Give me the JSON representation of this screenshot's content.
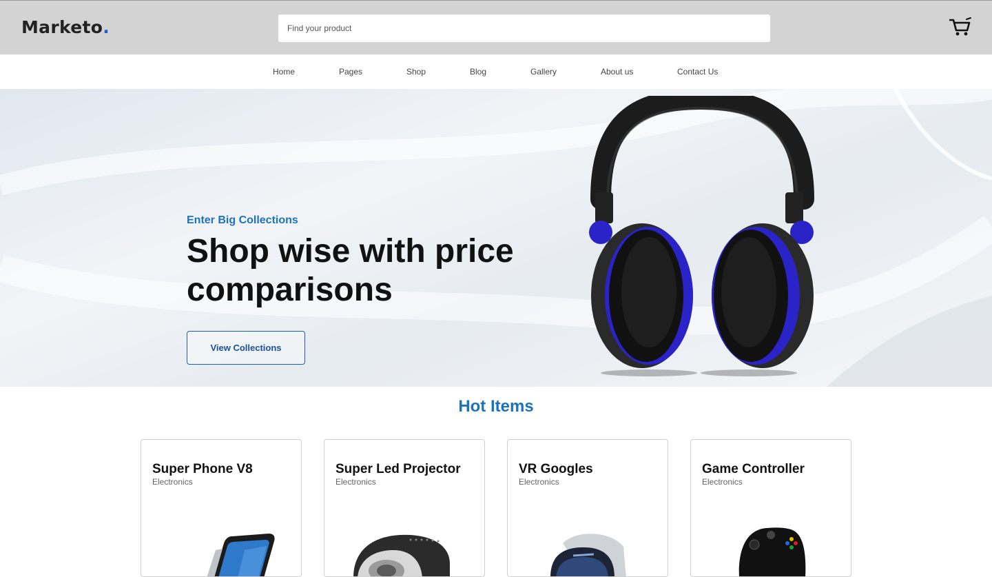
{
  "header": {
    "logo_text": "Marketo",
    "logo_dot": ".",
    "search_placeholder": "Find your product",
    "cart_icon": "shopping-cart-icon"
  },
  "nav": {
    "items": [
      "Home",
      "Pages",
      "Shop",
      "Blog",
      "Gallery",
      "About us",
      "Contact Us"
    ]
  },
  "hero": {
    "eyebrow": "Enter Big Collections",
    "headline": "Shop wise with price comparisons",
    "cta_label": "View Collections",
    "image": "headphones-image"
  },
  "hot_items": {
    "title": "Hot Items",
    "products": [
      {
        "name": "Super Phone V8",
        "category": "Electronics",
        "image": "smartphone-image"
      },
      {
        "name": "Super Led Projector",
        "category": "Electronics",
        "image": "projector-image"
      },
      {
        "name": "VR Googles",
        "category": "Electronics",
        "image": "vr-headset-image"
      },
      {
        "name": "Game Controller",
        "category": "Electronics",
        "image": "game-controller-image"
      }
    ]
  },
  "colors": {
    "accent_blue": "#1b73bd",
    "logo_dot": "#1a5fd6",
    "topbar_bg": "#d3d3d3",
    "headphone_blue": "#2a23c8"
  }
}
